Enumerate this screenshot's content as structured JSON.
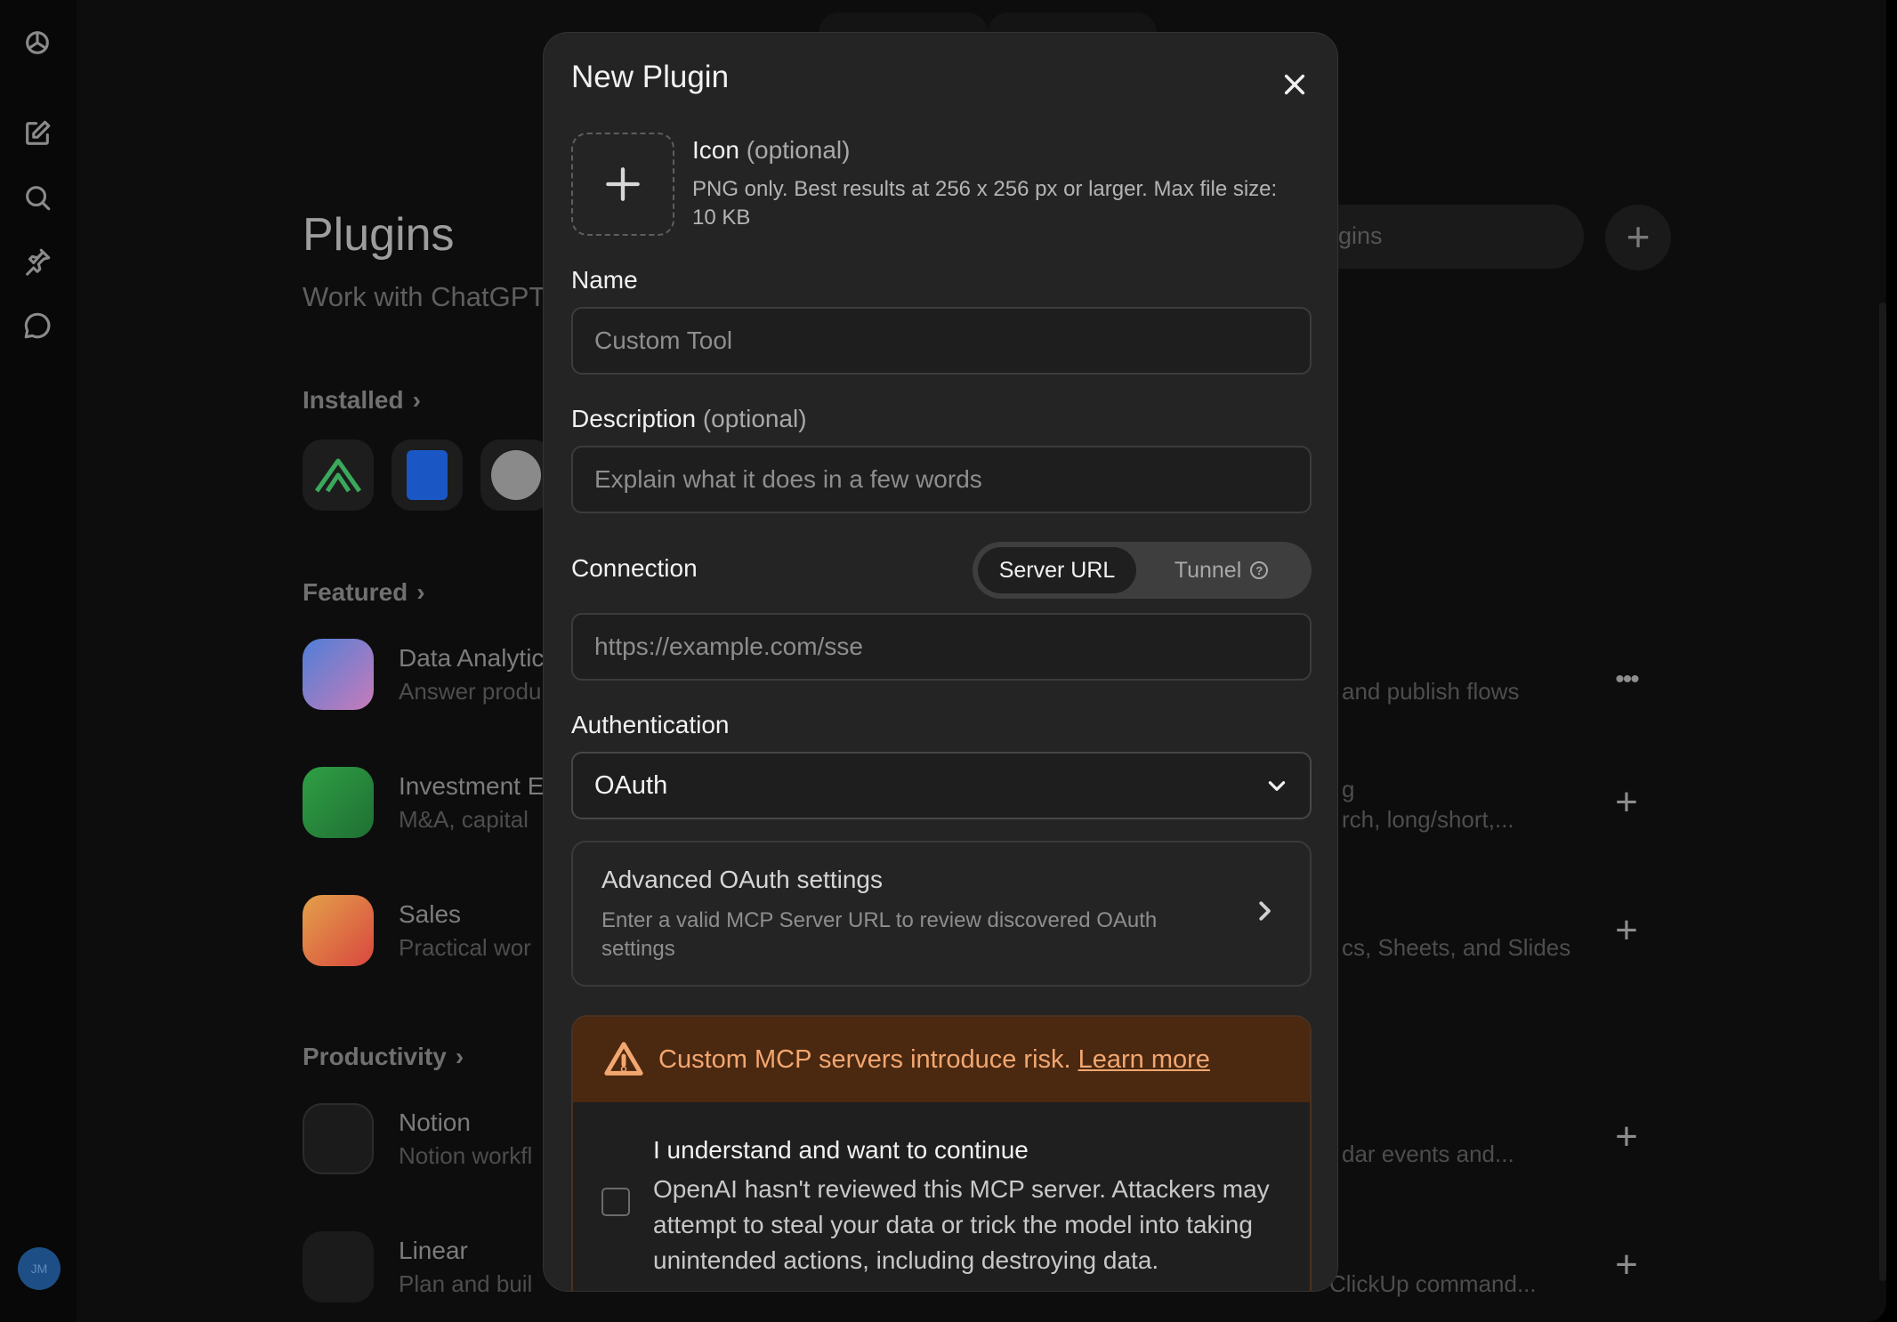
{
  "background": {
    "title": "Plugins",
    "subtitle": "Work with ChatGPT",
    "search_placeholder": "gins",
    "sections": {
      "installed": "Installed",
      "featured": "Featured",
      "productivity": "Productivity"
    },
    "featured_rows": [
      {
        "title": "Data Analytic",
        "desc": "Answer produ"
      },
      {
        "title": "Investment E",
        "desc": "M&A, capital"
      },
      {
        "title": "Sales",
        "desc": "Practical wor"
      }
    ],
    "productivity_rows": [
      {
        "title": "Notion",
        "desc": "Notion workfl"
      },
      {
        "title": "Linear",
        "desc": "Plan and buil"
      }
    ],
    "right_column": [
      "and publish flows",
      "g",
      "rch, long/short,...",
      "cs, Sheets, and Slides",
      "dar events and...",
      "ClickUp command..."
    ],
    "more_label": "•••",
    "avatar_initials": "JM"
  },
  "modal": {
    "title": "New Plugin",
    "icon": {
      "label": "Icon",
      "optional": "(optional)",
      "help": "PNG only. Best results at 256 x 256 px or larger. Max file size: 10 KB"
    },
    "name": {
      "label": "Name",
      "placeholder": "Custom Tool"
    },
    "description": {
      "label": "Description",
      "optional": "(optional)",
      "placeholder": "Explain what it does in a few words"
    },
    "connection": {
      "label": "Connection",
      "options": [
        "Server URL",
        "Tunnel"
      ],
      "selected": "Server URL",
      "url_placeholder": "https://example.com/sse"
    },
    "authentication": {
      "label": "Authentication",
      "selected": "OAuth"
    },
    "advanced": {
      "title": "Advanced OAuth settings",
      "desc": "Enter a valid MCP Server URL to review discovered OAuth settings"
    },
    "warning": {
      "text": "Custom MCP servers introduce risk.",
      "link": "Learn more",
      "color": "#f2a770",
      "background": "#4b2810"
    },
    "consent": {
      "title": "I understand and want to continue",
      "body": "OpenAI hasn't reviewed this MCP server. Attackers may attempt to steal your data or trick the model into taking unintended actions, including destroying data.",
      "checked": false
    }
  }
}
